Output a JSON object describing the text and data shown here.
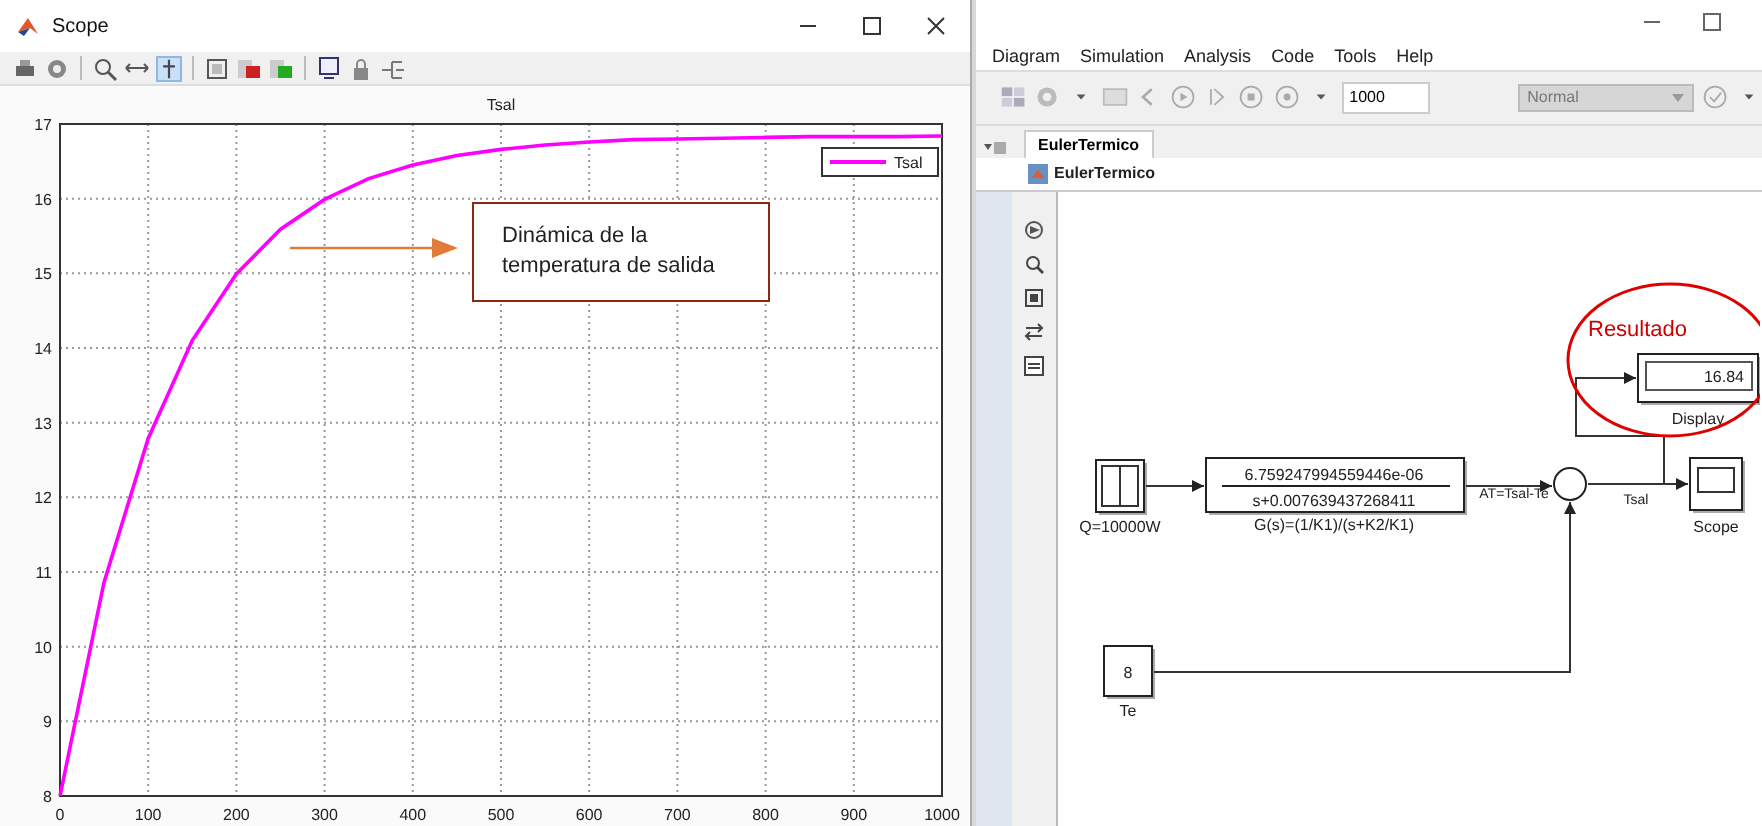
{
  "scope_window": {
    "title": "Scope",
    "chart_data": {
      "type": "line",
      "title": "Tsal",
      "x": [
        0,
        50,
        100,
        150,
        200,
        250,
        300,
        350,
        400,
        450,
        500,
        550,
        600,
        650,
        700,
        750,
        800,
        850,
        900,
        950,
        1000
      ],
      "series": [
        {
          "name": "Tsal",
          "color": "#ff00ff",
          "values": [
            8,
            10.86,
            12.79,
            14.1,
            14.99,
            15.59,
            15.99,
            16.27,
            16.45,
            16.58,
            16.66,
            16.72,
            16.76,
            16.79,
            16.8,
            16.81,
            16.82,
            16.83,
            16.83,
            16.83,
            16.84
          ]
        }
      ],
      "grid": true,
      "xlim": [
        0,
        1000
      ],
      "ylim": [
        8,
        17
      ],
      "xticks": [
        0,
        100,
        200,
        300,
        400,
        500,
        600,
        700,
        800,
        900,
        1000
      ],
      "yticks": [
        8,
        9,
        10,
        11,
        12,
        13,
        14,
        15,
        16,
        17
      ]
    },
    "annotation": "Dinámica de la temperatura de salida"
  },
  "model_window": {
    "menu": [
      "Diagram",
      "Simulation",
      "Analysis",
      "Code",
      "Tools",
      "Help"
    ],
    "stop_time": "1000",
    "sim_mode": "Normal",
    "tabs": [
      {
        "label": "EulerTermico",
        "selected": true
      }
    ],
    "breadcrumb": "EulerTermico",
    "diagram": {
      "blocks": [
        {
          "kind": "display",
          "value": "16.84",
          "label": "Display"
        },
        {
          "kind": "step",
          "label": "Q=10000W"
        },
        {
          "kind": "transfer_fcn",
          "numerator": "6.759247994559446e-06",
          "denominator": "s+0.007639437268411",
          "label": "G(s)=(1/K1)/(s+K2/K1)"
        },
        {
          "kind": "sum"
        },
        {
          "kind": "scope",
          "label": "Scope"
        },
        {
          "kind": "constant",
          "value": "8",
          "label": "Te"
        }
      ],
      "signals": [
        "AT=Tsal-Te",
        "Tsal"
      ],
      "callout": "Resultado"
    }
  }
}
